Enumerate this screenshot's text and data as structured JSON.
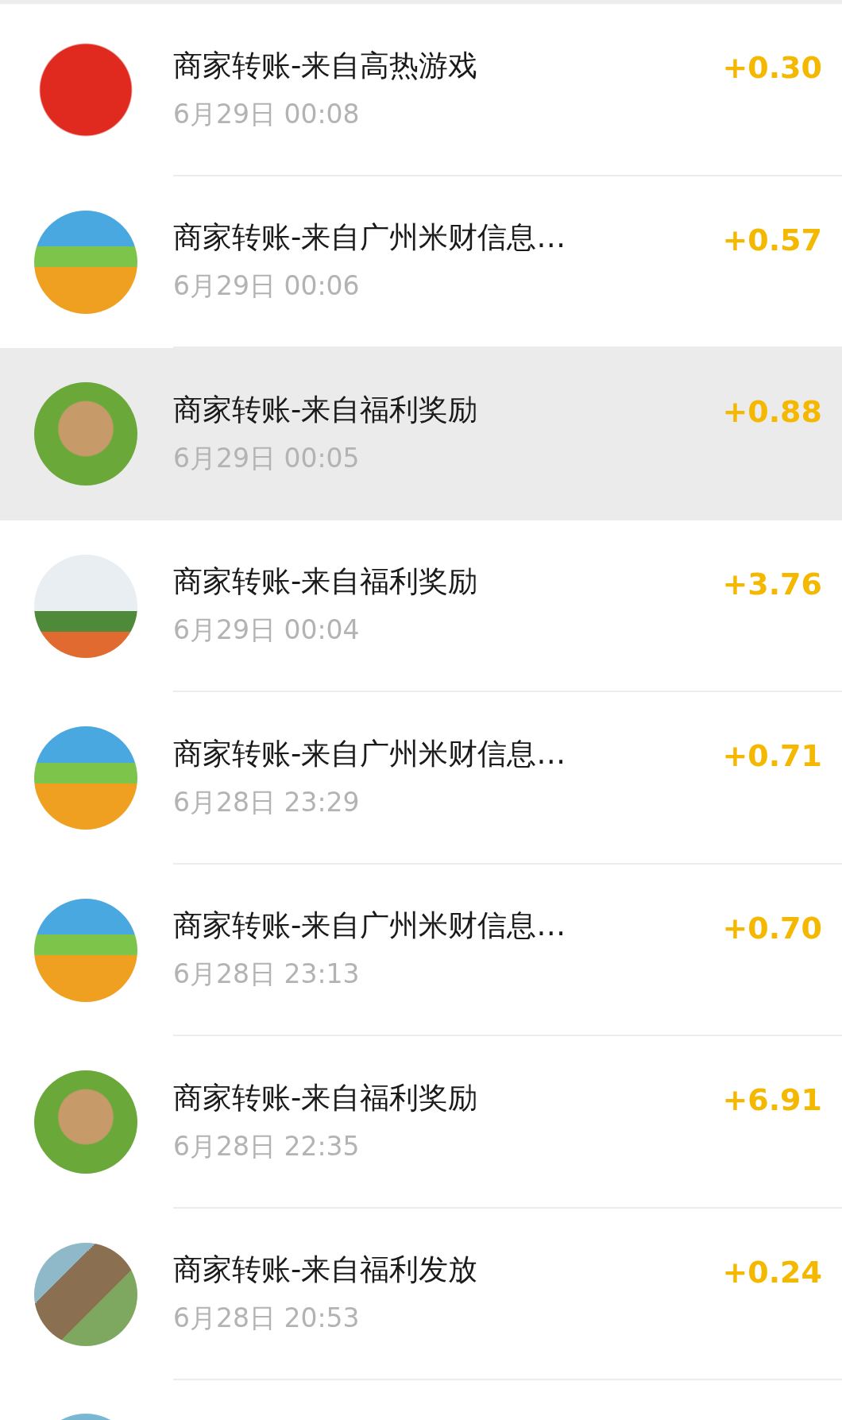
{
  "transactions": [
    {
      "kind": "mascot",
      "title": "商家转账-来自高热游戏",
      "time": "6月29日 00:08",
      "amount": "+0.30",
      "selected": false
    },
    {
      "kind": "beach",
      "title": "商家转账-来自广州米财信息…",
      "time": "6月29日 00:06",
      "amount": "+0.57",
      "selected": false
    },
    {
      "kind": "pot",
      "title": "商家转账-来自福利奖励",
      "time": "6月29日 00:05",
      "amount": "+0.88",
      "selected": true
    },
    {
      "kind": "girl",
      "title": "商家转账-来自福利奖励",
      "time": "6月29日 00:04",
      "amount": "+3.76",
      "selected": false
    },
    {
      "kind": "beach",
      "title": "商家转账-来自广州米财信息…",
      "time": "6月28日 23:29",
      "amount": "+0.71",
      "selected": false
    },
    {
      "kind": "beach",
      "title": "商家转账-来自广州米财信息…",
      "time": "6月28日 23:13",
      "amount": "+0.70",
      "selected": false
    },
    {
      "kind": "pot",
      "title": "商家转账-来自福利奖励",
      "time": "6月28日 22:35",
      "amount": "+6.91",
      "selected": false
    },
    {
      "kind": "village",
      "title": "商家转账-来自福利发放",
      "time": "6月28日 20:53",
      "amount": "+0.24",
      "selected": false
    }
  ]
}
